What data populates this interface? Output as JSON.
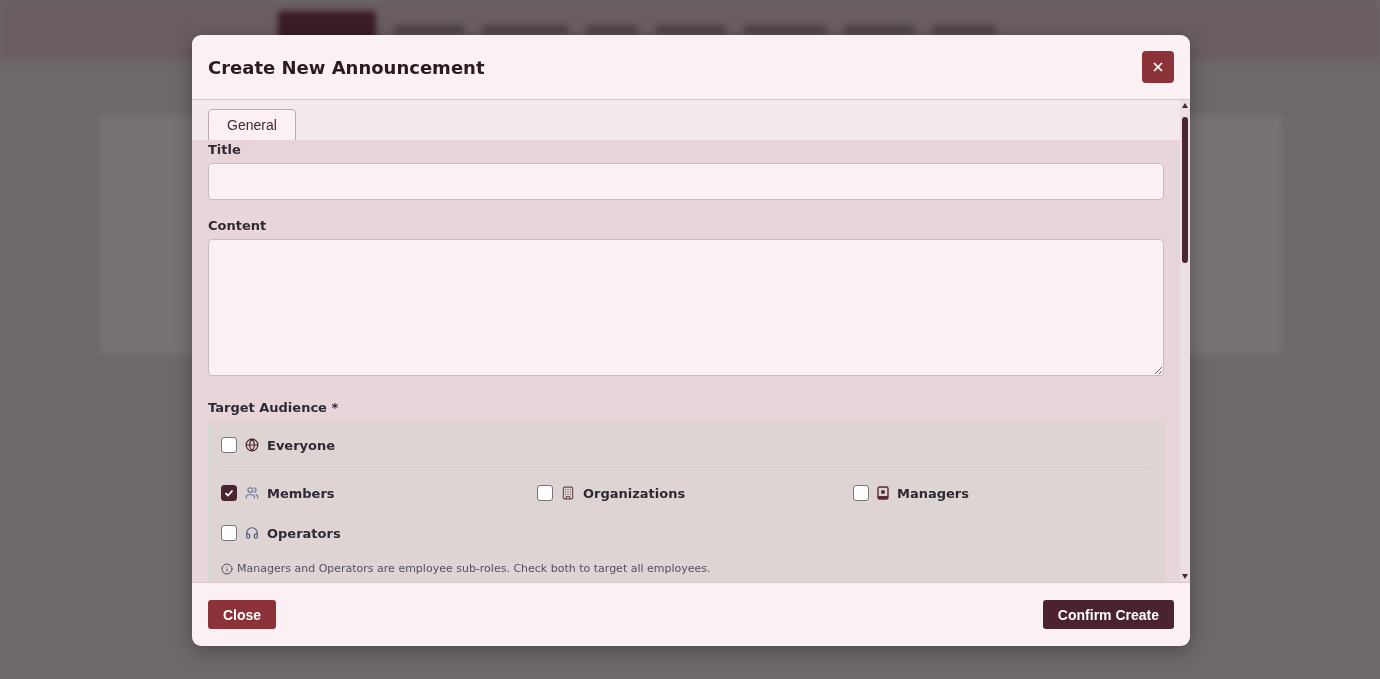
{
  "dialog": {
    "title": "Create New Announcement",
    "tabs": [
      {
        "label": "General",
        "selected": true
      }
    ],
    "fields": [
      {
        "label": "Title",
        "kind": "input"
      },
      {
        "label": "Content",
        "kind": "textarea"
      }
    ],
    "audience": {
      "label": "Target Audience *",
      "options": [
        {
          "label": "Everyone",
          "checked": false,
          "kind": "globe"
        },
        {
          "label": "Members",
          "checked": true,
          "kind": "people"
        },
        {
          "label": "Organizations",
          "checked": false,
          "kind": "building"
        },
        {
          "label": "Managers",
          "checked": false,
          "kind": "badge"
        },
        {
          "label": "Operators",
          "checked": false,
          "kind": "headset"
        }
      ],
      "hint": "Managers and Operators are employee sub-roles. Check both to target all employees."
    },
    "buttons": {
      "close": "Close",
      "confirm": "Confirm Create"
    }
  }
}
